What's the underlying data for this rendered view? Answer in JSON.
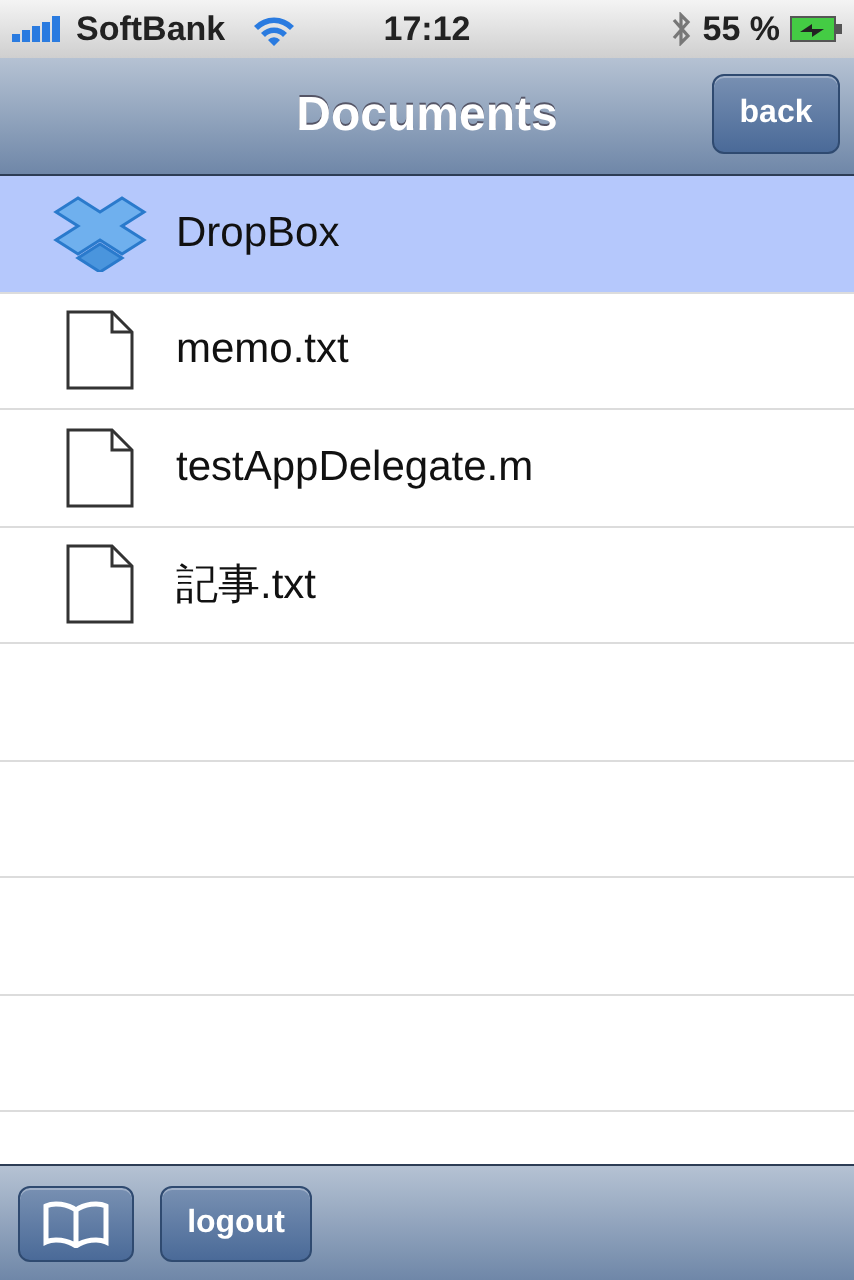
{
  "status_bar": {
    "carrier": "SoftBank",
    "time": "17:12",
    "battery": "55 %"
  },
  "nav_bar": {
    "title": "Documents",
    "button": "back"
  },
  "files": [
    {
      "name": "DropBox",
      "kind": "dropbox",
      "selected": true
    },
    {
      "name": "memo.txt",
      "kind": "file",
      "selected": false
    },
    {
      "name": "testAppDelegate.m",
      "kind": "file",
      "selected": false
    },
    {
      "name": "記事.txt",
      "kind": "file",
      "selected": false
    }
  ],
  "toolbar": {
    "button": "logout"
  }
}
